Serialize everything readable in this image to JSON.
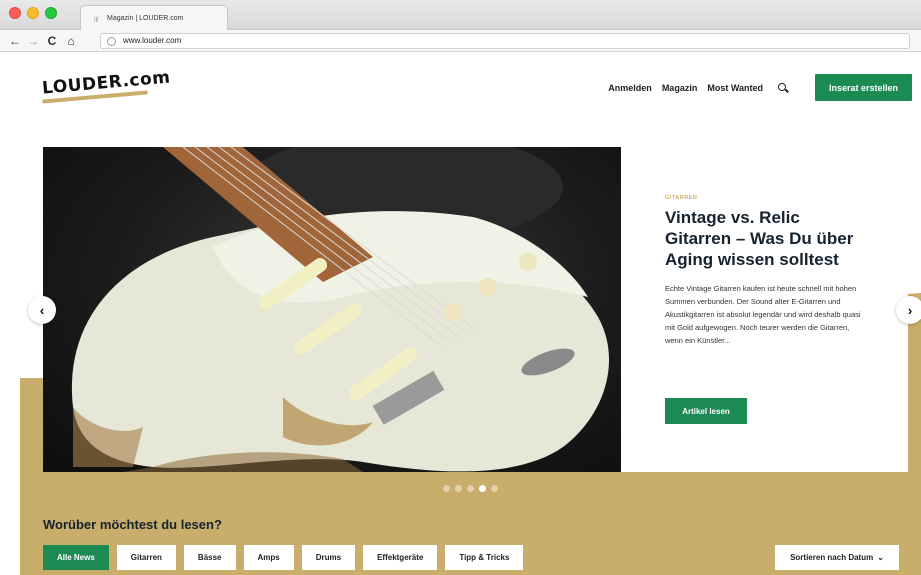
{
  "browser": {
    "tab_title": "Magazin | LOUDER.com",
    "url": "www.louder.com",
    "back_glyph": "←",
    "forward_glyph": "→",
    "reload_glyph": "C",
    "home_glyph": "⌂"
  },
  "header": {
    "logo": "LOUDER.com",
    "nav": [
      "Anmelden",
      "Magazin",
      "Most Wanted"
    ],
    "cta_label": "Inserat erstellen"
  },
  "hero": {
    "category": "GITARREN",
    "title": "Vintage vs. Relic Gitarren – Was Du über Aging wissen solltest",
    "excerpt": "Echte Vintage Gitarren kaufen ist heute schnell mit hohen Summen verbunden. Der Sound alter E-Gitarren und Akustikgitarren ist absolut legendär und wird deshalb quasi mit Gold aufgewogen. Noch teurer werden die Gitarren, wenn ein Künstler...",
    "button_label": "Artikel lesen",
    "prev_glyph": "‹",
    "next_glyph": "›",
    "slides_total": 5,
    "slide_active": 4
  },
  "filters_section": {
    "title": "Worüber möchtest du lesen?",
    "filters": [
      "Alle News",
      "Gitarren",
      "Bässe",
      "Amps",
      "Drums",
      "Effektgeräte",
      "Tipp & Tricks"
    ],
    "active_filter": "Alle News",
    "sort_label": "Sortieren nach Datum",
    "sort_caret": "⌄"
  },
  "colors": {
    "brand_green": "#1b8a53",
    "gold": "#c9ad6b",
    "navy_text": "#16232f"
  }
}
